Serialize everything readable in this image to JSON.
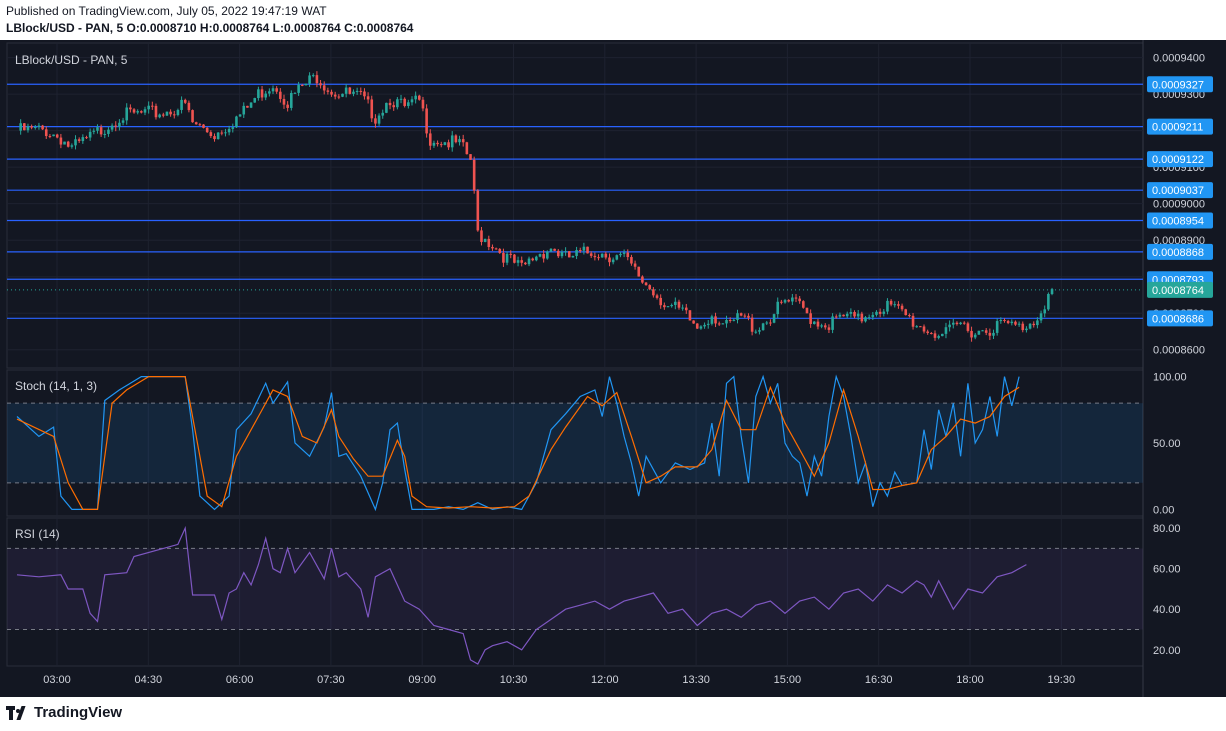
{
  "header": {
    "published": "Published on TradingView.com, July 05, 2022 19:47:19 WAT",
    "symbol_line": "LBlock/USD - PAN, 5",
    "ohlc": {
      "o_label": "O:",
      "o": "0.0008710",
      "h_label": "H:",
      "h": "0.0008764",
      "l_label": "L:",
      "l": "0.0008764",
      "c_label": "C:",
      "c": "0.0008764"
    }
  },
  "footer": {
    "brand": "TradingView"
  },
  "colors": {
    "background": "#131722",
    "grid": "#1e2230",
    "up": "#26a69a",
    "down": "#ef5350",
    "level_line": "#2962ff",
    "level_tag": "#2196f3",
    "last_price_tag": "#26a69a",
    "stoch_k": "#2196f3",
    "stoch_d": "#ff6d00",
    "rsi": "#7e57c2",
    "text": "#d1d4dc"
  },
  "chart_data": [
    {
      "type": "candlestick",
      "title": "LBlock/USD - PAN, 5",
      "x_ticks": [
        "03:00",
        "04:30",
        "06:00",
        "07:30",
        "09:00",
        "10:30",
        "12:00",
        "13:30",
        "15:00",
        "16:30",
        "18:00",
        "19:30"
      ],
      "y_ticks": [
        "0.0009400",
        "0.0009300",
        "0.0009200",
        "0.0009100",
        "0.0009000",
        "0.0008900",
        "0.0008800",
        "0.0008700",
        "0.0008600"
      ],
      "ylim": [
        0.000855,
        0.000944
      ],
      "horizontal_levels": [
        "0.0009327",
        "0.0009211",
        "0.0009122",
        "0.0009037",
        "0.0008954",
        "0.0008868",
        "0.0008793",
        "0.0008686"
      ],
      "last_price": "0.0008764",
      "close_path": [
        [
          0,
          0.00092
        ],
        [
          8,
          0.00092
        ],
        [
          12,
          0.000918
        ],
        [
          15,
          0.000915
        ],
        [
          20,
          0.000918
        ],
        [
          28,
          0.000924
        ],
        [
          40,
          0.000925
        ],
        [
          46,
          0.000927
        ],
        [
          48,
          0.000922
        ],
        [
          54,
          0.000919
        ],
        [
          58,
          0.000922
        ],
        [
          62,
          0.000925
        ],
        [
          66,
          0.00093
        ],
        [
          70,
          0.000933
        ],
        [
          74,
          0.000928
        ],
        [
          78,
          0.000932
        ],
        [
          82,
          0.000935
        ],
        [
          86,
          0.000931
        ],
        [
          90,
          0.00093
        ],
        [
          94,
          0.000929
        ],
        [
          98,
          0.000924
        ],
        [
          102,
          0.000929
        ],
        [
          106,
          0.000926
        ],
        [
          110,
          0.000928
        ],
        [
          113,
          0.000918
        ],
        [
          117,
          0.000917
        ],
        [
          121,
          0.000916
        ],
        [
          124,
          0.000912
        ],
        [
          126,
          0.000892
        ],
        [
          130,
          0.000889
        ],
        [
          134,
          0.000885
        ],
        [
          138,
          0.000882
        ],
        [
          142,
          0.000886
        ],
        [
          146,
          0.000888
        ],
        [
          150,
          0.000885
        ],
        [
          154,
          0.000886
        ],
        [
          158,
          0.000887
        ],
        [
          162,
          0.000886
        ],
        [
          166,
          0.000885
        ],
        [
          170,
          0.00088
        ],
        [
          174,
          0.000876
        ],
        [
          178,
          0.000872
        ],
        [
          182,
          0.00087
        ],
        [
          186,
          0.000866
        ],
        [
          190,
          0.00087
        ],
        [
          194,
          0.000866
        ],
        [
          198,
          0.000869
        ],
        [
          202,
          0.000866
        ],
        [
          206,
          0.000869
        ],
        [
          210,
          0.000873
        ],
        [
          214,
          0.000872
        ],
        [
          218,
          0.000868
        ],
        [
          222,
          0.000867
        ],
        [
          226,
          0.000869
        ],
        [
          230,
          0.000868
        ],
        [
          234,
          0.000871
        ],
        [
          238,
          0.000872
        ],
        [
          242,
          0.00087
        ],
        [
          246,
          0.000867
        ],
        [
          250,
          0.000865
        ],
        [
          254,
          0.000864
        ],
        [
          258,
          0.000867
        ],
        [
          262,
          0.000865
        ],
        [
          266,
          0.000866
        ],
        [
          270,
          0.000867
        ],
        [
          274,
          0.000866
        ],
        [
          278,
          0.000868
        ],
        [
          281,
          0.000873
        ],
        [
          283,
          0.000876
        ]
      ]
    },
    {
      "type": "line",
      "title": "Stoch (14, 1, 3)",
      "y_ticks": [
        "100.00",
        "50.00",
        "0.00"
      ],
      "ylim": [
        -5,
        105
      ],
      "bands": [
        20,
        80
      ],
      "k_series": [
        [
          0,
          70
        ],
        [
          6,
          55
        ],
        [
          10,
          62
        ],
        [
          12,
          10
        ],
        [
          15,
          0
        ],
        [
          22,
          0
        ],
        [
          24,
          82
        ],
        [
          28,
          90
        ],
        [
          34,
          100
        ],
        [
          46,
          100
        ],
        [
          48,
          60
        ],
        [
          50,
          10
        ],
        [
          54,
          0
        ],
        [
          58,
          10
        ],
        [
          60,
          60
        ],
        [
          64,
          72
        ],
        [
          68,
          95
        ],
        [
          70,
          80
        ],
        [
          74,
          96
        ],
        [
          76,
          50
        ],
        [
          80,
          40
        ],
        [
          84,
          62
        ],
        [
          86,
          88
        ],
        [
          88,
          40
        ],
        [
          90,
          42
        ],
        [
          94,
          25
        ],
        [
          98,
          0
        ],
        [
          100,
          20
        ],
        [
          102,
          60
        ],
        [
          104,
          65
        ],
        [
          106,
          30
        ],
        [
          108,
          0
        ],
        [
          114,
          0
        ],
        [
          118,
          2
        ],
        [
          122,
          0
        ],
        [
          126,
          5
        ],
        [
          130,
          0
        ],
        [
          134,
          2
        ],
        [
          138,
          0
        ],
        [
          142,
          20
        ],
        [
          146,
          60
        ],
        [
          150,
          72
        ],
        [
          154,
          85
        ],
        [
          158,
          90
        ],
        [
          160,
          70
        ],
        [
          162,
          100
        ],
        [
          164,
          80
        ],
        [
          166,
          55
        ],
        [
          168,
          35
        ],
        [
          170,
          10
        ],
        [
          172,
          40
        ],
        [
          176,
          20
        ],
        [
          180,
          35
        ],
        [
          184,
          30
        ],
        [
          188,
          35
        ],
        [
          190,
          65
        ],
        [
          192,
          25
        ],
        [
          194,
          95
        ],
        [
          196,
          100
        ],
        [
          198,
          55
        ],
        [
          200,
          20
        ],
        [
          202,
          85
        ],
        [
          204,
          100
        ],
        [
          206,
          80
        ],
        [
          208,
          95
        ],
        [
          210,
          50
        ],
        [
          212,
          40
        ],
        [
          214,
          35
        ],
        [
          216,
          10
        ],
        [
          218,
          40
        ],
        [
          220,
          25
        ],
        [
          222,
          70
        ],
        [
          224,
          100
        ],
        [
          226,
          85
        ],
        [
          228,
          55
        ],
        [
          230,
          20
        ],
        [
          232,
          35
        ],
        [
          234,
          2
        ],
        [
          236,
          20
        ],
        [
          238,
          10
        ],
        [
          240,
          28
        ],
        [
          242,
          18
        ],
        [
          246,
          20
        ],
        [
          248,
          60
        ],
        [
          250,
          30
        ],
        [
          252,
          75
        ],
        [
          254,
          55
        ],
        [
          256,
          80
        ],
        [
          258,
          40
        ],
        [
          260,
          95
        ],
        [
          262,
          50
        ],
        [
          264,
          60
        ],
        [
          266,
          85
        ],
        [
          268,
          55
        ],
        [
          270,
          100
        ],
        [
          272,
          78
        ],
        [
          274,
          100
        ]
      ],
      "d_series": [
        [
          0,
          68
        ],
        [
          10,
          55
        ],
        [
          14,
          20
        ],
        [
          18,
          0
        ],
        [
          22,
          0
        ],
        [
          26,
          80
        ],
        [
          30,
          90
        ],
        [
          36,
          100
        ],
        [
          46,
          100
        ],
        [
          49,
          55
        ],
        [
          52,
          10
        ],
        [
          56,
          2
        ],
        [
          60,
          40
        ],
        [
          66,
          70
        ],
        [
          70,
          90
        ],
        [
          74,
          85
        ],
        [
          78,
          55
        ],
        [
          82,
          50
        ],
        [
          86,
          75
        ],
        [
          88,
          55
        ],
        [
          92,
          38
        ],
        [
          96,
          25
        ],
        [
          100,
          25
        ],
        [
          104,
          52
        ],
        [
          106,
          40
        ],
        [
          108,
          10
        ],
        [
          112,
          2
        ],
        [
          118,
          1
        ],
        [
          124,
          2
        ],
        [
          130,
          1
        ],
        [
          136,
          2
        ],
        [
          140,
          10
        ],
        [
          146,
          45
        ],
        [
          150,
          62
        ],
        [
          156,
          85
        ],
        [
          160,
          78
        ],
        [
          164,
          88
        ],
        [
          168,
          55
        ],
        [
          172,
          20
        ],
        [
          176,
          25
        ],
        [
          180,
          32
        ],
        [
          186,
          32
        ],
        [
          190,
          45
        ],
        [
          194,
          82
        ],
        [
          198,
          60
        ],
        [
          202,
          60
        ],
        [
          206,
          92
        ],
        [
          210,
          65
        ],
        [
          214,
          45
        ],
        [
          218,
          25
        ],
        [
          222,
          50
        ],
        [
          226,
          90
        ],
        [
          230,
          55
        ],
        [
          234,
          15
        ],
        [
          238,
          15
        ],
        [
          242,
          18
        ],
        [
          246,
          20
        ],
        [
          250,
          45
        ],
        [
          254,
          55
        ],
        [
          258,
          68
        ],
        [
          262,
          65
        ],
        [
          266,
          70
        ],
        [
          270,
          85
        ],
        [
          274,
          92
        ]
      ]
    },
    {
      "type": "line",
      "title": "RSI (14)",
      "y_ticks": [
        "80.00",
        "60.00",
        "40.00",
        "20.00"
      ],
      "ylim": [
        12,
        85
      ],
      "bands": [
        30,
        70
      ],
      "series": [
        [
          0,
          57
        ],
        [
          6,
          56
        ],
        [
          12,
          57
        ],
        [
          14,
          50
        ],
        [
          18,
          50
        ],
        [
          20,
          38
        ],
        [
          22,
          34
        ],
        [
          24,
          57
        ],
        [
          30,
          58
        ],
        [
          32,
          66
        ],
        [
          40,
          70
        ],
        [
          44,
          72
        ],
        [
          46,
          80
        ],
        [
          48,
          47
        ],
        [
          54,
          47
        ],
        [
          56,
          35
        ],
        [
          58,
          48
        ],
        [
          60,
          50
        ],
        [
          62,
          58
        ],
        [
          64,
          52
        ],
        [
          66,
          62
        ],
        [
          68,
          75
        ],
        [
          70,
          60
        ],
        [
          72,
          58
        ],
        [
          74,
          70
        ],
        [
          76,
          58
        ],
        [
          80,
          68
        ],
        [
          84,
          55
        ],
        [
          86,
          70
        ],
        [
          88,
          56
        ],
        [
          90,
          58
        ],
        [
          94,
          50
        ],
        [
          96,
          36
        ],
        [
          98,
          56
        ],
        [
          102,
          60
        ],
        [
          106,
          44
        ],
        [
          110,
          40
        ],
        [
          114,
          32
        ],
        [
          118,
          30
        ],
        [
          122,
          28
        ],
        [
          124,
          15
        ],
        [
          126,
          13
        ],
        [
          128,
          20
        ],
        [
          130,
          22
        ],
        [
          134,
          24
        ],
        [
          138,
          20
        ],
        [
          142,
          30
        ],
        [
          146,
          35
        ],
        [
          150,
          40
        ],
        [
          154,
          42
        ],
        [
          158,
          44
        ],
        [
          162,
          40
        ],
        [
          166,
          44
        ],
        [
          170,
          46
        ],
        [
          174,
          48
        ],
        [
          178,
          38
        ],
        [
          182,
          40
        ],
        [
          186,
          32
        ],
        [
          190,
          38
        ],
        [
          194,
          40
        ],
        [
          198,
          36
        ],
        [
          202,
          42
        ],
        [
          206,
          44
        ],
        [
          210,
          38
        ],
        [
          214,
          44
        ],
        [
          218,
          46
        ],
        [
          222,
          40
        ],
        [
          226,
          48
        ],
        [
          230,
          50
        ],
        [
          234,
          44
        ],
        [
          238,
          52
        ],
        [
          242,
          48
        ],
        [
          246,
          54
        ],
        [
          248,
          52
        ],
        [
          250,
          46
        ],
        [
          252,
          54
        ],
        [
          256,
          40
        ],
        [
          260,
          50
        ],
        [
          264,
          48
        ],
        [
          268,
          56
        ],
        [
          272,
          58
        ],
        [
          276,
          62
        ]
      ]
    }
  ]
}
